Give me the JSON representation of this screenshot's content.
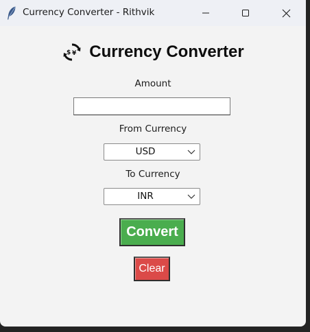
{
  "window": {
    "title": "Currency Converter - Rithvik"
  },
  "header": {
    "title": "Currency Converter",
    "icon": "currency-exchange-icon"
  },
  "form": {
    "amount_label": "Amount",
    "amount_value": "",
    "from_label": "From Currency",
    "from_value": "USD",
    "to_label": "To Currency",
    "to_value": "INR",
    "convert_label": "Convert",
    "clear_label": "Clear"
  },
  "colors": {
    "convert_button": "#4aad4e",
    "clear_button": "#db4a48",
    "window_background": "#f3f3f3",
    "titlebar_background": "#eef0f5"
  }
}
